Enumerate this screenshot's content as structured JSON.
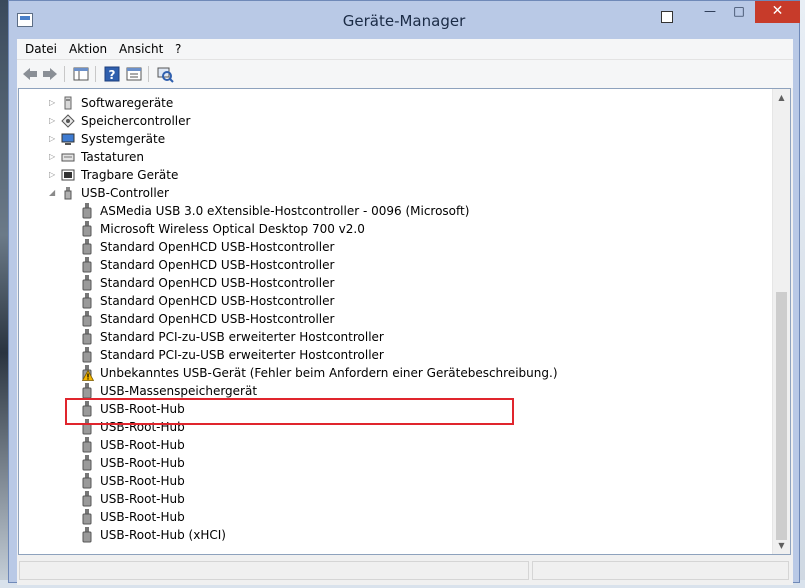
{
  "window": {
    "title": "Geräte-Manager",
    "buttons": {
      "minimize": "—",
      "maximize": "□",
      "close": "✕"
    }
  },
  "menu": {
    "items": [
      "Datei",
      "Aktion",
      "Ansicht",
      "?"
    ]
  },
  "toolbar": {
    "buttons": [
      "back-arrow-icon",
      "forward-arrow-icon",
      "show-hide-console-tree-icon",
      "help-icon",
      "properties-icon",
      "scan-hardware-icon"
    ]
  },
  "tree": {
    "categories": [
      {
        "label": "Softwaregeräte",
        "expanded": false,
        "icon": "software-device-icon"
      },
      {
        "label": "Speichercontroller",
        "expanded": false,
        "icon": "storage-controller-icon"
      },
      {
        "label": "Systemgeräte",
        "expanded": false,
        "icon": "system-device-icon"
      },
      {
        "label": "Tastaturen",
        "expanded": false,
        "icon": "keyboard-icon"
      },
      {
        "label": "Tragbare Geräte",
        "expanded": false,
        "icon": "portable-device-icon"
      },
      {
        "label": "USB-Controller",
        "expanded": true,
        "icon": "usb-controller-icon"
      }
    ],
    "usb_devices": [
      {
        "label": "ASMedia USB 3.0 eXtensible-Hostcontroller - 0096 (Microsoft)",
        "warning": false
      },
      {
        "label": "Microsoft Wireless Optical Desktop 700 v2.0",
        "warning": false
      },
      {
        "label": "Standard OpenHCD USB-Hostcontroller",
        "warning": false
      },
      {
        "label": "Standard OpenHCD USB-Hostcontroller",
        "warning": false
      },
      {
        "label": "Standard OpenHCD USB-Hostcontroller",
        "warning": false
      },
      {
        "label": "Standard OpenHCD USB-Hostcontroller",
        "warning": false
      },
      {
        "label": "Standard OpenHCD USB-Hostcontroller",
        "warning": false
      },
      {
        "label": "Standard PCI-zu-USB erweiterter Hostcontroller",
        "warning": false
      },
      {
        "label": "Standard PCI-zu-USB erweiterter Hostcontroller",
        "warning": false
      },
      {
        "label": "Unbekanntes USB-Gerät (Fehler beim Anfordern einer Gerätebeschreibung.)",
        "warning": true
      },
      {
        "label": "USB-Massenspeichergerät",
        "warning": false
      },
      {
        "label": "USB-Root-Hub",
        "warning": false
      },
      {
        "label": "USB-Root-Hub",
        "warning": false
      },
      {
        "label": "USB-Root-Hub",
        "warning": false
      },
      {
        "label": "USB-Root-Hub",
        "warning": false
      },
      {
        "label": "USB-Root-Hub",
        "warning": false
      },
      {
        "label": "USB-Root-Hub",
        "warning": false
      },
      {
        "label": "USB-Root-Hub",
        "warning": false
      },
      {
        "label": "USB-Root-Hub (xHCI)",
        "warning": false
      }
    ]
  },
  "colors": {
    "highlight_border": "#e0252d",
    "warning": "#f2b400",
    "title_bar": "#b9c9e6",
    "close_button": "#c73b2a"
  }
}
